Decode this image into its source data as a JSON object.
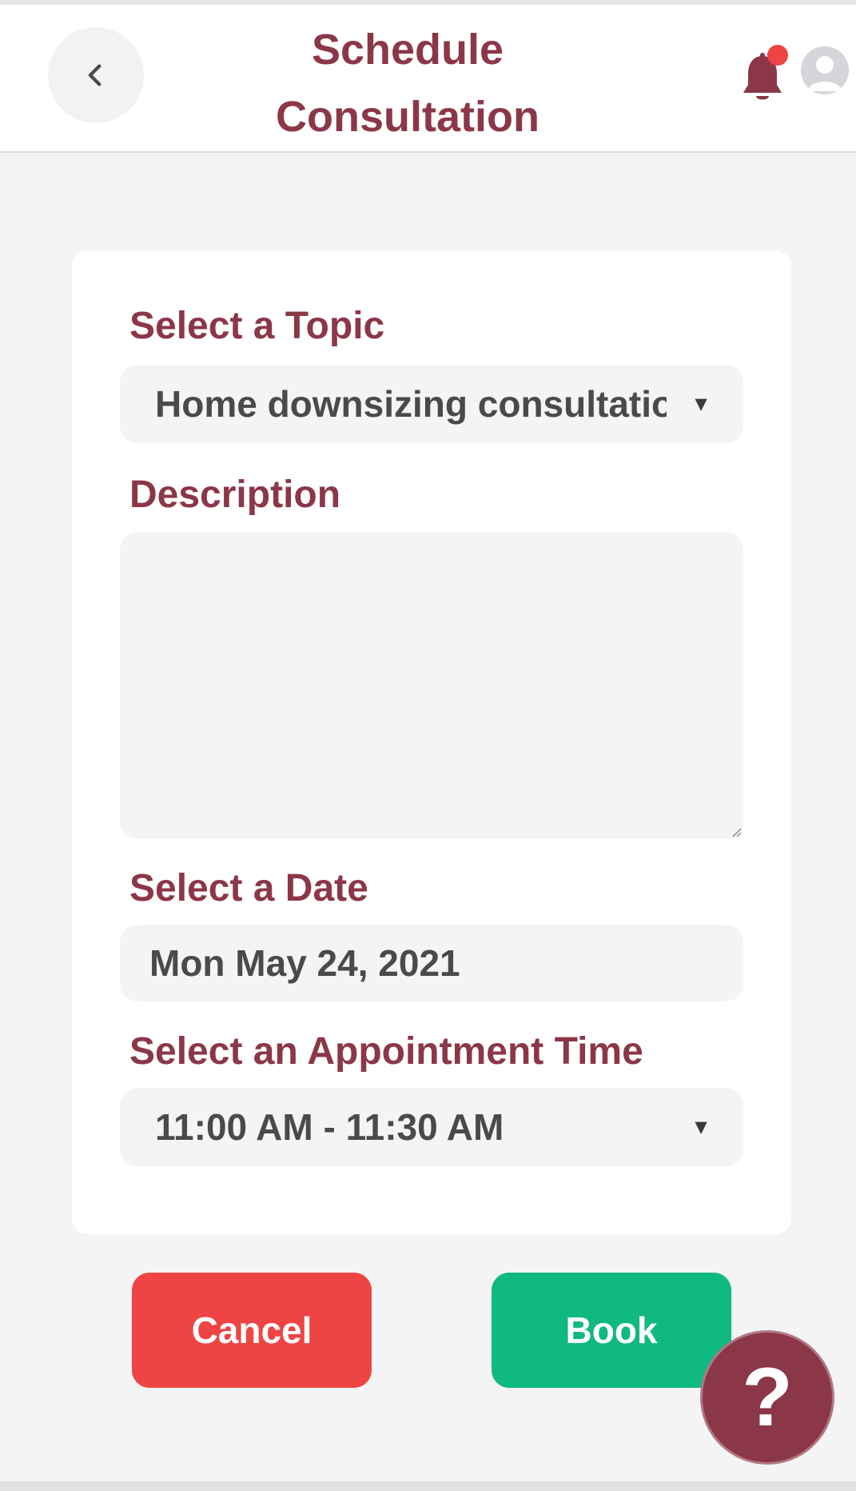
{
  "header": {
    "title": "Schedule Consultation",
    "back_icon": "chevron-left-icon",
    "notification_icon": "bell-icon",
    "profile_icon": "user-avatar-icon",
    "has_notification": true
  },
  "form": {
    "topic": {
      "label": "Select a Topic",
      "selected": "Home downsizing consultation"
    },
    "description": {
      "label": "Description",
      "value": ""
    },
    "date": {
      "label": "Select a Date",
      "value": "Mon May 24, 2021"
    },
    "time": {
      "label": "Select an Appointment Time",
      "selected": "11:00 AM - 11:30 AM"
    }
  },
  "actions": {
    "cancel_label": "Cancel",
    "book_label": "Book",
    "help_label": "?"
  },
  "colors": {
    "brand": "#8b3748",
    "cancel": "#ef4444",
    "book": "#10b981",
    "notification_dot": "#ef4444",
    "field_bg": "#f4f4f4"
  }
}
